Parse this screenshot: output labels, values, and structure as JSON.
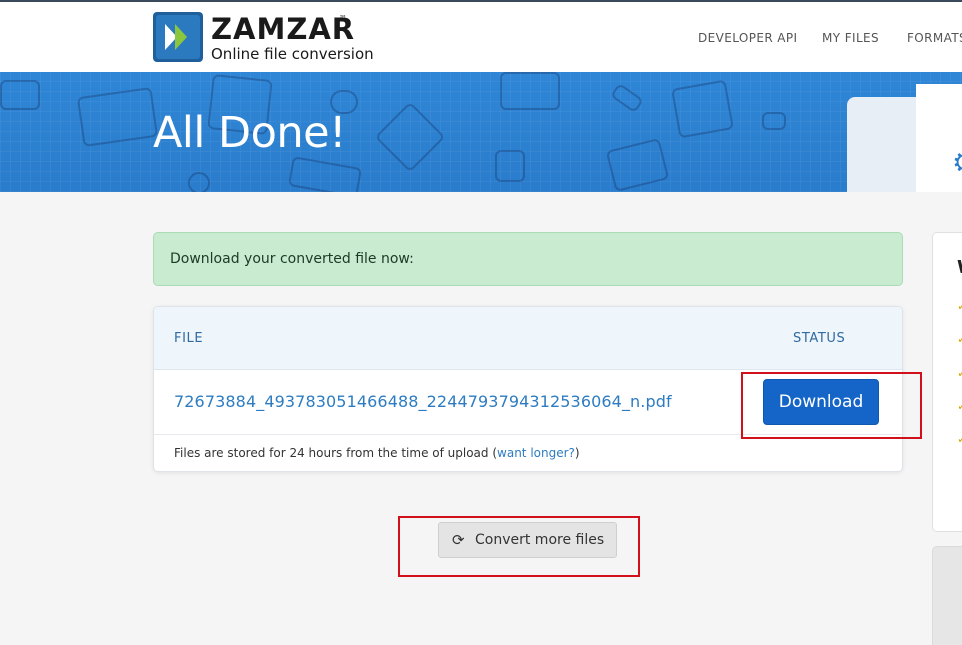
{
  "header": {
    "logo_name": "ZAMZAR",
    "logo_tm": "™",
    "logo_tagline": "Online file conversion",
    "nav": {
      "developer_api": "DEVELOPER API",
      "my_files": "MY FILES",
      "formats": "FORMATS"
    }
  },
  "banner": {
    "title": "All Done!"
  },
  "alert": {
    "text": "Download your converted file now:"
  },
  "table": {
    "columns": [
      "FILE",
      "STATUS"
    ],
    "rows": [
      {
        "file_name": "72673884_493783051466488_2244793794312536064_n.pdf",
        "action_label": "Download"
      }
    ],
    "footer_text": "Files are stored for 24 hours from the time of upload (",
    "footer_link": "want longer?",
    "footer_close": ")"
  },
  "convert_more": {
    "label": "Convert more files",
    "icon": "refresh-icon"
  },
  "side_panel": {
    "heading_initial": "W"
  },
  "colors": {
    "banner_blue": "#2a7ccc",
    "button_blue": "#1565c8",
    "link_blue": "#2d7cc1",
    "alert_green": "#c9ecd0",
    "highlight_red": "#d0101a"
  }
}
